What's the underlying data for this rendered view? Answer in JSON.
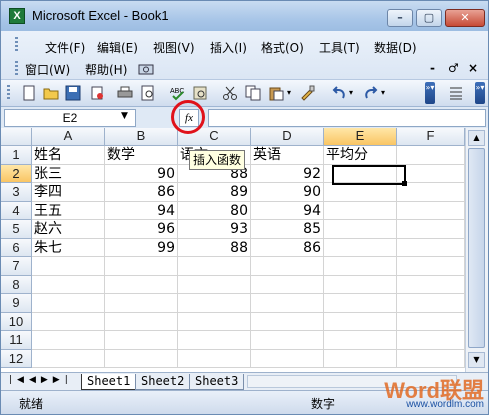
{
  "window": {
    "title": "Microsoft Excel - Book1",
    "app_icon_glyph": "X"
  },
  "menubar": {
    "row1": [
      "文件(F)",
      "编辑(E)",
      "视图(V)",
      "插入(I)",
      "格式(O)",
      "工具(T)",
      "数据(D)"
    ],
    "row2": [
      "窗口(W)",
      "帮助(H)"
    ],
    "doc_controls": [
      "-",
      "♂",
      "×"
    ]
  },
  "formula_bar": {
    "name_box": "E2",
    "fx_label": "fx",
    "formula": ""
  },
  "tooltip": "插入函数",
  "columns": [
    "A",
    "B",
    "C",
    "D",
    "E",
    "F"
  ],
  "active_column": "E",
  "active_row": "2",
  "rows": [
    {
      "num": "1",
      "A": "姓名",
      "B": "数学",
      "C": "语文",
      "D": "英语",
      "E": "平均分"
    },
    {
      "num": "2",
      "A": "张三",
      "B": "90",
      "C": "88",
      "D": "92",
      "E": ""
    },
    {
      "num": "3",
      "A": "李四",
      "B": "86",
      "C": "89",
      "D": "90",
      "E": ""
    },
    {
      "num": "4",
      "A": "王五",
      "B": "94",
      "C": "80",
      "D": "94",
      "E": ""
    },
    {
      "num": "5",
      "A": "赵六",
      "B": "96",
      "C": "93",
      "D": "85",
      "E": ""
    },
    {
      "num": "6",
      "A": "朱七",
      "B": "99",
      "C": "88",
      "D": "86",
      "E": ""
    },
    {
      "num": "7",
      "A": "",
      "B": "",
      "C": "",
      "D": "",
      "E": ""
    },
    {
      "num": "8",
      "A": "",
      "B": "",
      "C": "",
      "D": "",
      "E": ""
    },
    {
      "num": "9",
      "A": "",
      "B": "",
      "C": "",
      "D": "",
      "E": ""
    },
    {
      "num": "10",
      "A": "",
      "B": "",
      "C": "",
      "D": "",
      "E": ""
    },
    {
      "num": "11",
      "A": "",
      "B": "",
      "C": "",
      "D": "",
      "E": ""
    },
    {
      "num": "12",
      "A": "",
      "B": "",
      "C": "",
      "D": "",
      "E": ""
    }
  ],
  "sheet_tabs": [
    "Sheet1",
    "Sheet2",
    "Sheet3"
  ],
  "status": {
    "left": "就绪",
    "right": "数字"
  },
  "watermark": {
    "logo": "Word联盟",
    "url": "www.wordlm.com"
  },
  "colors": {
    "accent_circle": "#e0121b",
    "tooltip_bg": "#ffffe1",
    "active_header": "#f9c564"
  }
}
